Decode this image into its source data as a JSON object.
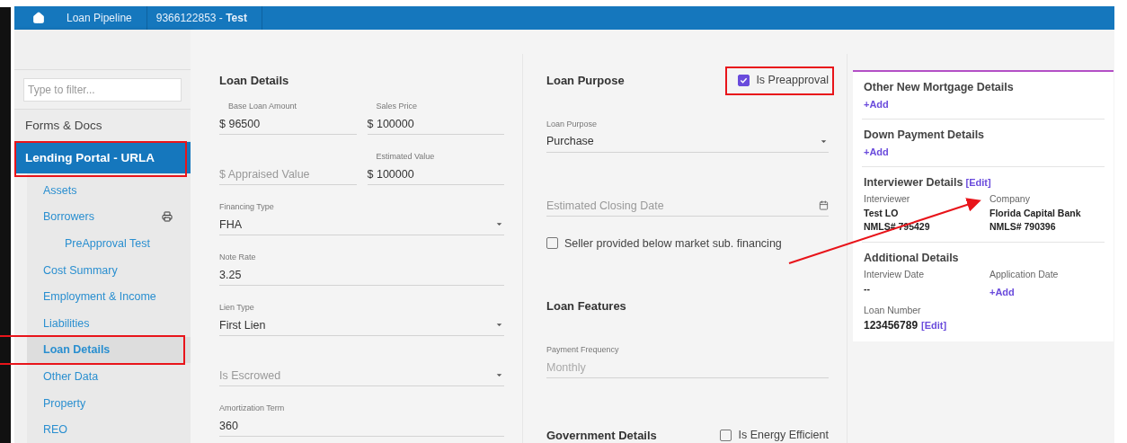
{
  "nav": {
    "items": [
      "Loan Pipeline"
    ],
    "loan": "9366122853 - **Test**"
  },
  "sidebar": {
    "filter": {
      "placeholder": "Type to filter..."
    },
    "sections": [
      {
        "label": "Forms & Docs",
        "selected": false,
        "highlighted": false
      },
      {
        "label": "Lending Portal - URLA",
        "selected": true,
        "highlighted": true,
        "children": [
          {
            "label": "Assets",
            "selected": false,
            "highlighted": false
          },
          {
            "label": "Borrowers",
            "selected": false,
            "highlighted": false,
            "printable": true,
            "children": [
              {
                "label": "PreApproval Test",
                "selected": false,
                "highlighted": false
              }
            ]
          },
          {
            "label": "Cost Summary",
            "selected": false,
            "highlighted": false
          },
          {
            "label": "Employment & Income",
            "selected": false,
            "highlighted": false
          },
          {
            "label": "Liabilities",
            "selected": false,
            "highlighted": false
          },
          {
            "label": "Loan Details",
            "selected": true,
            "highlighted": true
          },
          {
            "label": "Other Data",
            "selected": false,
            "highlighted": false
          },
          {
            "label": "Property",
            "selected": false,
            "highlighted": false
          },
          {
            "label": "REO",
            "selected": false,
            "highlighted": false
          }
        ]
      }
    ]
  },
  "loan_details": {
    "title": "Loan Details",
    "rows": [
      [
        {
          "kind": "text",
          "label": "Base Loan Amount",
          "value": "$ 96500"
        },
        {
          "kind": "text",
          "label": "Sales Price",
          "value": "$ 100000"
        }
      ],
      [
        {
          "kind": "text",
          "placeholder": "$ Appraised Value"
        },
        {
          "kind": "text",
          "label": "Estimated Value",
          "value": "$ 100000"
        }
      ],
      [
        {
          "kind": "select",
          "label": "Financing Type",
          "value": "FHA"
        }
      ],
      [
        {
          "kind": "text",
          "label": "Note Rate",
          "value": "3.25"
        }
      ],
      [
        {
          "kind": "select",
          "label": "Lien Type",
          "value": "First Lien"
        }
      ],
      [
        {
          "kind": "select",
          "placeholder": "Is Escrowed"
        }
      ],
      [
        {
          "kind": "text",
          "label": "Amortization Term",
          "value": "360"
        }
      ]
    ]
  },
  "loan_purpose": {
    "title": "Loan Purpose",
    "preapproval": {
      "label": "Is Preapproval",
      "checked": true,
      "highlighted": true
    },
    "items": [
      {
        "kind": "select",
        "label": "Loan Purpose",
        "value": "Purchase"
      },
      {
        "kind": "date",
        "placeholder": "Estimated Closing Date"
      },
      {
        "kind": "checkbox",
        "label": "Seller provided below market sub. financing",
        "checked": false
      }
    ]
  },
  "loan_features": {
    "title": "Loan Features",
    "items": [
      {
        "kind": "text",
        "label": "Payment Frequency",
        "value": "Monthly",
        "disabled": true
      }
    ]
  },
  "government": {
    "title": "Government Details",
    "checkbox": {
      "label": "Is Energy Efficient",
      "checked": false
    }
  },
  "details_panel": {
    "sections": [
      {
        "title": "Other New Mortgage Details",
        "add": "+Add"
      },
      {
        "title": "Down Payment Details",
        "add": "+Add"
      },
      {
        "title": "Interviewer Details",
        "edit": "[Edit]",
        "columns": [
          {
            "label": "Interviewer",
            "lines": [
              "Test LO",
              "NMLS# 795429"
            ]
          },
          {
            "label": "Company",
            "lines": [
              "Florida Capital Bank",
              "NMLS# 790396"
            ]
          }
        ]
      },
      {
        "title": "Additional Details",
        "columns": [
          {
            "label": "Interview Date",
            "lines": [
              "--"
            ]
          },
          {
            "label": "Application Date",
            "add": "+Add"
          }
        ],
        "loan_number": {
          "label": "Loan Number",
          "value": "123456789",
          "edit": "[Edit]"
        }
      }
    ]
  },
  "annotation_arrow": true
}
